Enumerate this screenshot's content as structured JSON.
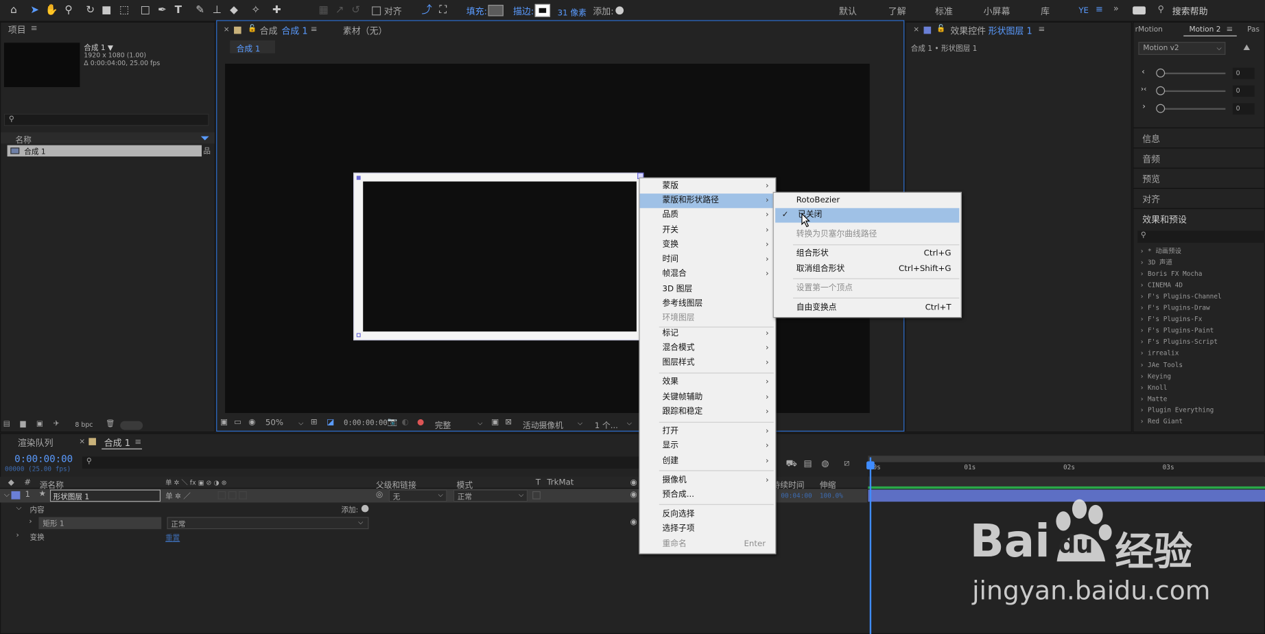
{
  "toolbar": {
    "align_label": "对齐",
    "fill_label": "填充:",
    "stroke_label": "描边:",
    "stroke_width": "31 像素",
    "add_label": "添加:",
    "workspaces": [
      "默认",
      "了解",
      "标准",
      "小屏幕",
      "库"
    ],
    "ye_label": "YE",
    "search_placeholder": "搜索帮助"
  },
  "project": {
    "title": "项目",
    "comp_name": "合成 1 ▼",
    "comp_res": "1920 x 1080 (1.00)",
    "comp_dur": "Δ 0:00:04:00, 25.00 fps",
    "col_name": "名称",
    "item": "合成 1",
    "bpc": "8 bpc"
  },
  "comp_panel": {
    "tab_prefix": "合成",
    "tab_name": "合成 1",
    "footage_tab": "素材（无）",
    "sub_tab": "合成 1",
    "zoom": "50%",
    "timecode": "0:00:00:00",
    "quality": "完整",
    "camera": "活动摄像机",
    "views": "1 个..."
  },
  "effects_panel": {
    "tab_label": "效果控件",
    "layer_name": "形状图层 1",
    "breadcrumb": "合成 1 • 形状图层 1"
  },
  "motion_panel": {
    "tab1": "rMotion",
    "tab2": "Motion 2",
    "tab3": "Pas",
    "dropdown": "Motion v2",
    "sliders": [
      {
        "icon": "‹",
        "value": "0"
      },
      {
        "icon": "›‹",
        "value": "0"
      },
      {
        "icon": "›",
        "value": "0"
      }
    ]
  },
  "right_panels": [
    "信息",
    "音频",
    "预览",
    "对齐",
    "效果和预设"
  ],
  "effects_list": [
    "* 动画预设",
    "3D 声道",
    "Boris FX Mocha",
    "CINEMA 4D",
    "F's Plugins-Channel",
    "F's Plugins-Draw",
    "F's Plugins-Fx",
    "F's Plugins-Paint",
    "F's Plugins-Script",
    "irrealix",
    "JAe Tools",
    "Keying",
    "Knoll",
    "Matte",
    "Plugin Everything",
    "Red Giant"
  ],
  "context_menu": {
    "items": [
      {
        "label": "蒙版",
        "arrow": "›"
      },
      {
        "label": "蒙版和形状路径",
        "arrow": "›"
      },
      {
        "label": "品质",
        "arrow": "›"
      },
      {
        "label": "开关",
        "arrow": "›"
      },
      {
        "label": "变换",
        "arrow": "›"
      },
      {
        "label": "时间",
        "arrow": "›"
      },
      {
        "label": "帧混合",
        "arrow": "›"
      },
      {
        "label": "3D 图层",
        "arrow": ""
      },
      {
        "label": "参考线图层",
        "arrow": ""
      },
      {
        "label": "环境图层",
        "arrow": ""
      },
      {
        "label": "标记",
        "arrow": "›"
      },
      {
        "label": "混合模式",
        "arrow": "›"
      },
      {
        "label": "图层样式",
        "arrow": "›"
      },
      {
        "label": "效果",
        "arrow": "›"
      },
      {
        "label": "关键帧辅助",
        "arrow": "›"
      },
      {
        "label": "跟踪和稳定",
        "arrow": "›"
      },
      {
        "label": "打开",
        "arrow": "›"
      },
      {
        "label": "显示",
        "arrow": "›"
      },
      {
        "label": "创建",
        "arrow": "›"
      },
      {
        "label": "摄像机",
        "arrow": "›"
      },
      {
        "label": "预合成...",
        "arrow": ""
      },
      {
        "label": "反向选择",
        "arrow": ""
      },
      {
        "label": "选择子项",
        "arrow": ""
      },
      {
        "label": "重命名",
        "shortcut": "Enter"
      }
    ]
  },
  "submenu": {
    "items": [
      {
        "label": "RotoBezier",
        "shortcut": ""
      },
      {
        "label": "已关闭",
        "shortcut": "",
        "checkmark": "✓"
      },
      {
        "label": "转换为贝塞尔曲线路径",
        "shortcut": ""
      },
      {
        "label": "组合形状",
        "shortcut": "Ctrl+G"
      },
      {
        "label": "取消组合形状",
        "shortcut": "Ctrl+Shift+G"
      },
      {
        "label": "设置第一个顶点",
        "shortcut": ""
      },
      {
        "label": "自由变换点",
        "shortcut": "Ctrl+T"
      }
    ]
  },
  "timeline": {
    "render_queue_tab": "渲染队列",
    "comp_tab": "合成 1",
    "timecode": "0:00:00:00",
    "frames": "00000 (25.00 fps)",
    "col_num": "#",
    "col_source": "源名称",
    "col_parent": "父级和链接",
    "col_mode": "模式",
    "col_t": "T",
    "col_trkmat": "TrkMat",
    "col_duration": "持续时间",
    "col_stretch": "伸缩",
    "layer_num": "1",
    "layer_name": "形状图层 1",
    "parent_value": "无",
    "mode_value": "正常",
    "duration_value": "00:04:00",
    "stretch_value": "100.0%",
    "contents_label": "内容",
    "add_label": "添加:",
    "rect_label": "矩形 1",
    "rect_mode": "正常",
    "transform_label": "变换",
    "reset_label": "重置",
    "ruler": [
      "0s",
      "01s",
      "02s",
      "03s"
    ]
  },
  "watermark": {
    "brand": "Bai",
    "brand_du": "du",
    "brand_cn": "经验",
    "url": "jingyan.baidu.com"
  }
}
